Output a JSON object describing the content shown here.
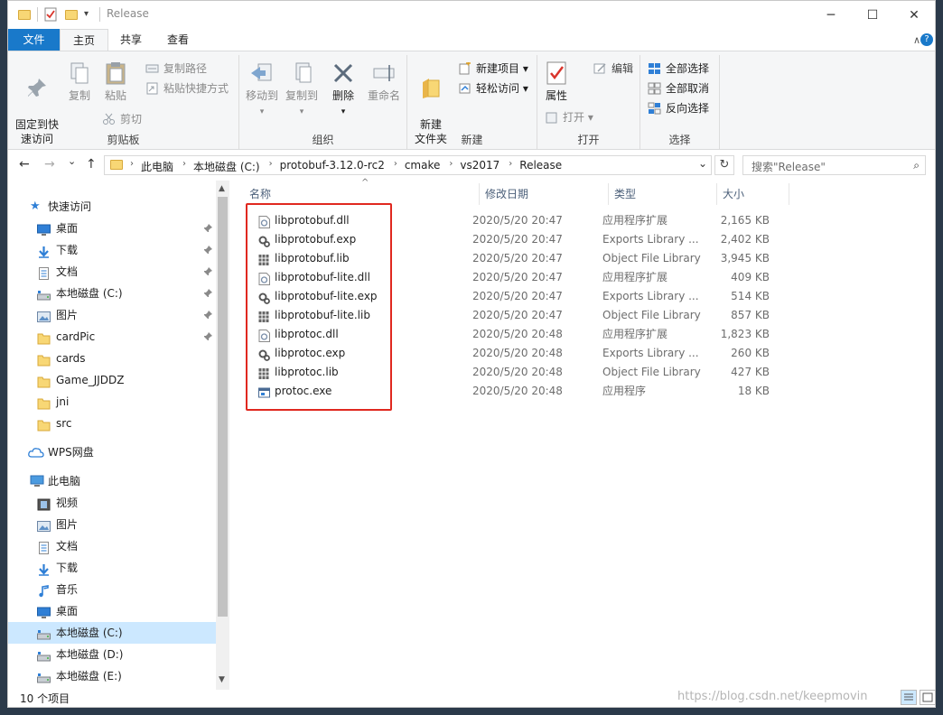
{
  "window": {
    "title": "Release",
    "minimize": "─",
    "maximize": "☐",
    "close": "✕"
  },
  "tabs": [
    "文件",
    "主页",
    "共享",
    "查看"
  ],
  "ribbon": {
    "collapse": "∧",
    "help": "?",
    "clipboard": {
      "label": "剪贴板",
      "pin": "固定到快\n速访问",
      "copy": "复制",
      "paste": "粘贴",
      "copy_path": "复制路径",
      "paste_shortcut": "粘贴快捷方式",
      "cut": "剪切"
    },
    "organize": {
      "label": "组织",
      "move_to": "移动到",
      "copy_to": "复制到",
      "delete": "删除",
      "rename": "重命名"
    },
    "new": {
      "label": "新建",
      "new_folder": "新建\n文件夹",
      "new_item": "新建项目 ▾",
      "easy_access": "轻松访问 ▾"
    },
    "open": {
      "label": "打开",
      "properties": "属性",
      "open": "打开 ▾",
      "edit": "编辑"
    },
    "select": {
      "label": "选择",
      "select_all": "全部选择",
      "select_none": "全部取消",
      "invert": "反向选择"
    }
  },
  "nav": {
    "back": "←",
    "forward": "→",
    "dropdown": "⌄",
    "up": "↑",
    "refresh": "↻",
    "addr_dropdown": "⌄"
  },
  "breadcrumb": [
    "此电脑",
    "本地磁盘 (C:)",
    "protobuf-3.12.0-rc2",
    "cmake",
    "vs2017",
    "Release"
  ],
  "search": {
    "placeholder": "搜索\"Release\"",
    "icon": "⌕"
  },
  "sidebar": {
    "quick_access": "快速访问",
    "items": [
      {
        "label": "桌面",
        "icon": "desktop-icon",
        "pinned": true
      },
      {
        "label": "下载",
        "icon": "download-icon",
        "pinned": true
      },
      {
        "label": "文档",
        "icon": "document-icon",
        "pinned": true
      },
      {
        "label": "本地磁盘 (C:)",
        "icon": "drive-icon",
        "pinned": true
      },
      {
        "label": "图片",
        "icon": "pictures-icon",
        "pinned": true
      },
      {
        "label": "cardPic",
        "icon": "folder-icon",
        "pinned": true
      },
      {
        "label": "cards",
        "icon": "folder-icon",
        "pinned": false
      },
      {
        "label": "Game_JJDDZ",
        "icon": "folder-icon",
        "pinned": false
      },
      {
        "label": "jni",
        "icon": "folder-icon",
        "pinned": false
      },
      {
        "label": "src",
        "icon": "folder-icon",
        "pinned": false
      }
    ],
    "wps": "WPS网盘",
    "this_pc": "此电脑",
    "pc_items": [
      {
        "label": "视频",
        "icon": "video-icon"
      },
      {
        "label": "图片",
        "icon": "pictures-icon"
      },
      {
        "label": "文档",
        "icon": "document-icon"
      },
      {
        "label": "下载",
        "icon": "download-icon"
      },
      {
        "label": "音乐",
        "icon": "music-icon"
      },
      {
        "label": "桌面",
        "icon": "desktop-icon"
      },
      {
        "label": "本地磁盘 (C:)",
        "icon": "drive-icon",
        "selected": true
      },
      {
        "label": "本地磁盘 (D:)",
        "icon": "drive-icon"
      },
      {
        "label": "本地磁盘 (E:)",
        "icon": "drive-icon"
      }
    ],
    "pin_glyph": "📌"
  },
  "columns": {
    "name": "名称",
    "date": "修改日期",
    "type": "类型",
    "size": "大小",
    "sort": "^"
  },
  "files": [
    {
      "name": "libprotobuf.dll",
      "date": "2020/5/20 20:47",
      "type": "应用程序扩展",
      "size": "2,165 KB",
      "kind": "dll"
    },
    {
      "name": "libprotobuf.exp",
      "date": "2020/5/20 20:47",
      "type": "Exports Library ...",
      "size": "2,402 KB",
      "kind": "exp"
    },
    {
      "name": "libprotobuf.lib",
      "date": "2020/5/20 20:47",
      "type": "Object File Library",
      "size": "3,945 KB",
      "kind": "lib"
    },
    {
      "name": "libprotobuf-lite.dll",
      "date": "2020/5/20 20:47",
      "type": "应用程序扩展",
      "size": "409 KB",
      "kind": "dll"
    },
    {
      "name": "libprotobuf-lite.exp",
      "date": "2020/5/20 20:47",
      "type": "Exports Library ...",
      "size": "514 KB",
      "kind": "exp"
    },
    {
      "name": "libprotobuf-lite.lib",
      "date": "2020/5/20 20:47",
      "type": "Object File Library",
      "size": "857 KB",
      "kind": "lib"
    },
    {
      "name": "libprotoc.dll",
      "date": "2020/5/20 20:48",
      "type": "应用程序扩展",
      "size": "1,823 KB",
      "kind": "dll"
    },
    {
      "name": "libprotoc.exp",
      "date": "2020/5/20 20:48",
      "type": "Exports Library ...",
      "size": "260 KB",
      "kind": "exp"
    },
    {
      "name": "libprotoc.lib",
      "date": "2020/5/20 20:48",
      "type": "Object File Library",
      "size": "427 KB",
      "kind": "lib"
    },
    {
      "name": "protoc.exe",
      "date": "2020/5/20 20:48",
      "type": "应用程序",
      "size": "18 KB",
      "kind": "exe"
    }
  ],
  "status": {
    "count": "10 个项目"
  },
  "watermark": "https://blog.csdn.net/keepmovin",
  "colors": {
    "accent": "#1979ca",
    "highlight": "#e0281f",
    "selected": "#cce8ff"
  }
}
